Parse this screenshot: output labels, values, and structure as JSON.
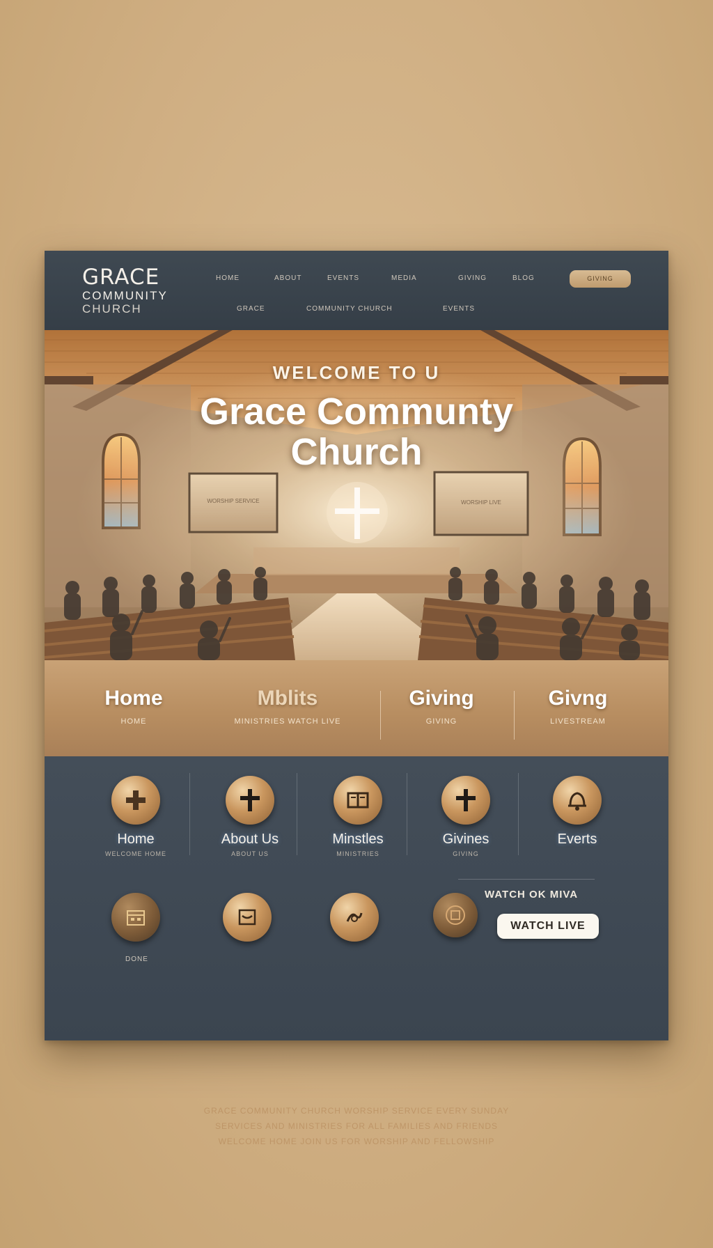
{
  "header": {
    "logo": {
      "line1": "GRACE",
      "line2": "COMMUNITY",
      "line3": "CHURCH"
    },
    "nav_top": [
      "HOME",
      "ABOUT",
      "EVENTS",
      "MEDIA",
      "GIVING",
      "BLOG"
    ],
    "nav_sub": [
      "GRACE",
      "COMMUNITY CHURCH",
      "EVENTS"
    ],
    "cta_button": "GIVING"
  },
  "hero": {
    "kicker": "WELCOME TO U",
    "title_line1": "Grace Communty",
    "title_line2": "Church",
    "screen_left_text": "WORSHIP SERVICE",
    "screen_right_text": "WORSHIP LIVE"
  },
  "nav_band": {
    "items": [
      {
        "label": "Home",
        "sub": "HOME"
      },
      {
        "label": "Mblits",
        "sub": "MINISTRIES WATCH LIVE"
      },
      {
        "label": "Giving",
        "sub": "GIVING"
      },
      {
        "label": "Givng",
        "sub": "LIVESTREAM"
      }
    ]
  },
  "icon_grid": {
    "row1": [
      {
        "label": "Home",
        "sub": "WELCOME HOME",
        "icon": "plus-icon"
      },
      {
        "label": "About Us",
        "sub": "ABOUT US",
        "icon": "cross-icon"
      },
      {
        "label": "Minstles",
        "sub": "MINISTRIES",
        "icon": "book-icon"
      },
      {
        "label": "Givines",
        "sub": "GIVING",
        "icon": "cross-icon"
      },
      {
        "label": "Everts",
        "sub": "",
        "icon": "bell-icon"
      }
    ],
    "row2": [
      {
        "label": "DONE",
        "icon": "calendar-icon"
      },
      {
        "label": "",
        "icon": "message-icon"
      },
      {
        "label": "",
        "icon": "hands-icon"
      },
      {
        "label": "",
        "icon": "emblem-icon"
      }
    ],
    "watch_caption": "WATCH OK MIVA",
    "watch_button": "WATCH LIVE"
  },
  "footer": {
    "lines": [
      "GRACE COMMUNITY CHURCH WORSHIP SERVICE EVERY SUNDAY",
      "SERVICES AND MINISTRIES FOR ALL FAMILIES AND FRIENDS",
      "WELCOME HOME JOIN US FOR WORSHIP AND FELLOWSHIP"
    ]
  },
  "colors": {
    "page_background": "#cfae82",
    "header_bg": "#3b444d",
    "band_gold": "#bb9064",
    "panel_slate": "#414b56",
    "disc_gold": "#c9965e"
  }
}
